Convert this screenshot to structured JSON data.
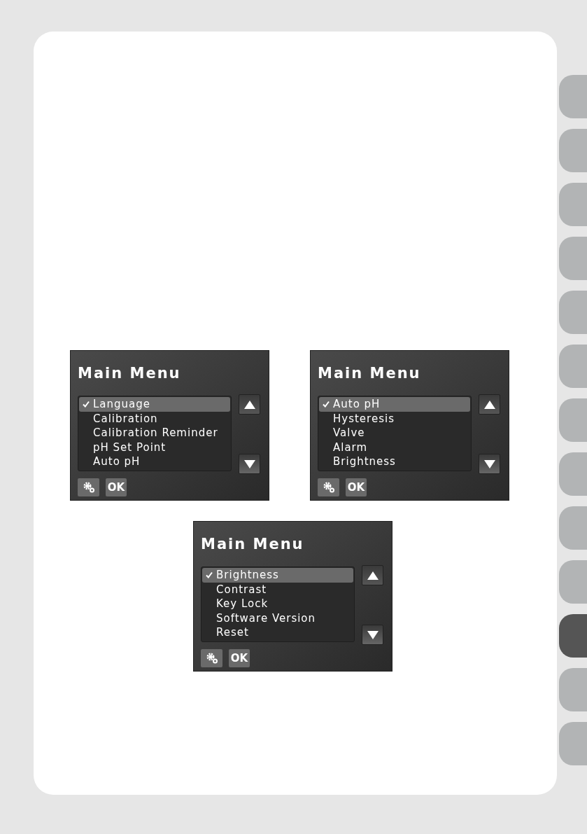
{
  "screens": [
    {
      "title": "Main Menu",
      "items": [
        {
          "label": "Language",
          "selected": true
        },
        {
          "label": "Calibration",
          "selected": false
        },
        {
          "label": "Calibration Reminder",
          "selected": false
        },
        {
          "label": "pH Set Point",
          "selected": false
        },
        {
          "label": "Auto pH",
          "selected": false
        }
      ],
      "ok_button": "OK"
    },
    {
      "title": "Main Menu",
      "items": [
        {
          "label": "Auto pH",
          "selected": true
        },
        {
          "label": "Hysteresis",
          "selected": false
        },
        {
          "label": "Valve",
          "selected": false
        },
        {
          "label": "Alarm",
          "selected": false
        },
        {
          "label": "Brightness",
          "selected": false
        }
      ],
      "ok_button": "OK"
    },
    {
      "title": "Main Menu",
      "items": [
        {
          "label": "Brightness",
          "selected": true
        },
        {
          "label": "Contrast",
          "selected": false
        },
        {
          "label": "Key Lock",
          "selected": false
        },
        {
          "label": "Software Version",
          "selected": false
        },
        {
          "label": "Reset",
          "selected": false
        }
      ],
      "ok_button": "OK"
    }
  ],
  "side_tabs": [
    {
      "selected": false
    },
    {
      "selected": false
    },
    {
      "selected": false
    },
    {
      "selected": false
    },
    {
      "selected": false
    },
    {
      "selected": false
    },
    {
      "selected": false
    },
    {
      "selected": false
    },
    {
      "selected": false
    },
    {
      "selected": false
    },
    {
      "selected": true
    },
    {
      "selected": false
    },
    {
      "selected": false
    }
  ]
}
